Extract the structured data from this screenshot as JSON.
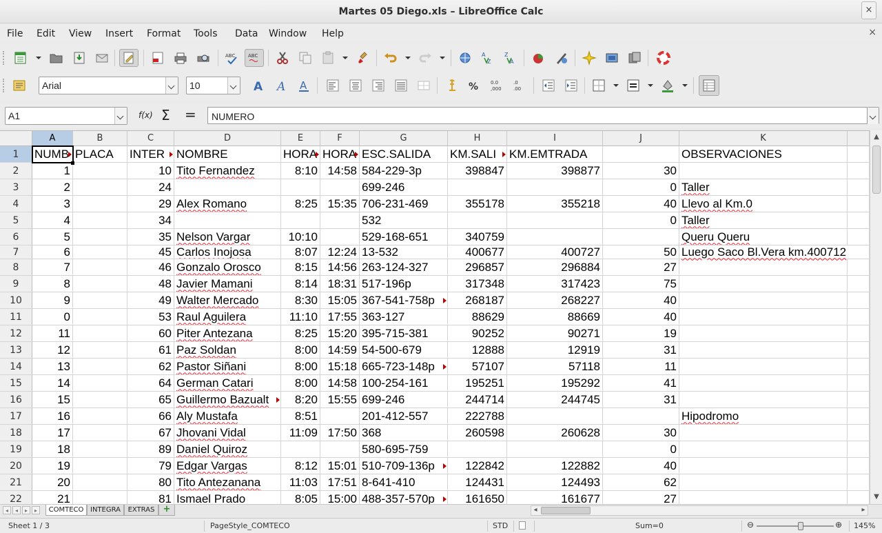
{
  "window": {
    "title": "Martes 05 Diego.xls – LibreOffice Calc",
    "close_glyph": "×"
  },
  "menu": [
    "File",
    "Edit",
    "View",
    "Insert",
    "Format",
    "Tools",
    "Data",
    "Window",
    "Help"
  ],
  "toolbar": {
    "font_name": "Arial",
    "font_size": "10"
  },
  "formula_bar": {
    "name_box": "A1",
    "content": "NUMERO",
    "fx_label": "f(x)",
    "sum_label": "Σ",
    "equals_label": "="
  },
  "columns": [
    "A",
    "B",
    "C",
    "D",
    "E",
    "F",
    "G",
    "H",
    "I",
    "J",
    "K"
  ],
  "column_right_of_k": "",
  "header_row": [
    "NUMB",
    "PLACA",
    "INTER",
    "NOMBRE",
    "HORA",
    "HORA",
    "ESC.SALIDA",
    "KM.SALI",
    "KM.EMTRADA",
    "",
    "OBSERVACIONES"
  ],
  "rows": [
    [
      "1",
      "",
      "10",
      "Tito Fernandez",
      "8:10",
      "14:58",
      "584-229-3p",
      "398847",
      "398877",
      "30",
      ""
    ],
    [
      "2",
      "",
      "24",
      "",
      "",
      "",
      "699-246",
      "",
      "",
      "0",
      "Taller"
    ],
    [
      "3",
      "",
      "29",
      "Alex Romano",
      "8:25",
      "15:35",
      "706-231-469",
      "355178",
      "355218",
      "40",
      "Llevo al Km.0"
    ],
    [
      "4",
      "",
      "34",
      "",
      "",
      "",
      "532",
      "",
      "",
      "0",
      "Taller"
    ],
    [
      "5",
      "",
      "35",
      "Nelson Vargar",
      "10:10",
      "",
      "529-168-651",
      "340759",
      "",
      "",
      "Queru Queru"
    ],
    [
      "6",
      "",
      "45",
      "Carlos Inojosa",
      "8:07",
      "12:24",
      "13-532",
      "400677",
      "400727",
      "50",
      "Luego Saco Bl.Vera km.400712"
    ],
    [
      "7",
      "",
      "46",
      "Gonzalo Orosco",
      "8:15",
      "14:56",
      "263-124-327",
      "296857",
      "296884",
      "27",
      ""
    ],
    [
      "8",
      "",
      "48",
      "Javier Mamani",
      "8:14",
      "18:31",
      "517-196p",
      "317348",
      "317423",
      "75",
      ""
    ],
    [
      "9",
      "",
      "49",
      "Walter Mercado",
      "8:30",
      "15:05",
      "367-541-758p",
      "268187",
      "268227",
      "40",
      ""
    ],
    [
      "0",
      "",
      "53",
      "Raul Aguilera",
      "11:10",
      "17:55",
      "363-127",
      "88629",
      "88669",
      "40",
      ""
    ],
    [
      "11",
      "",
      "60",
      "Piter Antezana",
      "8:25",
      "15:20",
      "395-715-381",
      "90252",
      "90271",
      "19",
      ""
    ],
    [
      "12",
      "",
      "61",
      "Paz Soldan",
      "8:00",
      "14:59",
      "54-500-679",
      "12888",
      "12919",
      "31",
      ""
    ],
    [
      "13",
      "",
      "62",
      "Pastor Siñani",
      "8:00",
      "15:18",
      "665-723-148p",
      "57107",
      "57118",
      "11",
      ""
    ],
    [
      "14",
      "",
      "64",
      "German Catari",
      "8:00",
      "14:58",
      "100-254-161",
      "195251",
      "195292",
      "41",
      ""
    ],
    [
      "15",
      "",
      "65",
      "Guillermo Bazualt",
      "8:20",
      "15:55",
      "699-246",
      "244714",
      "244745",
      "31",
      ""
    ],
    [
      "16",
      "",
      "66",
      "Aly Mustafa",
      "8:51",
      "",
      "201-412-557",
      "222788",
      "",
      "",
      "Hipodromo"
    ],
    [
      "17",
      "",
      "67",
      "Jhovani Vidal",
      "11:09",
      "17:50",
      "368",
      "260598",
      "260628",
      "30",
      ""
    ],
    [
      "18",
      "",
      "89",
      "Daniel Quiroz",
      "",
      "",
      "580-695-759",
      "",
      "",
      "0",
      ""
    ],
    [
      "19",
      "",
      "79",
      "Edgar Vargas",
      "8:12",
      "15:01",
      "510-709-136p",
      "122842",
      "122882",
      "40",
      ""
    ],
    [
      "20",
      "",
      "80",
      "Tito Antezanana",
      "11:03",
      "17:51",
      "8-641-410",
      "124431",
      "124493",
      "62",
      ""
    ],
    [
      "21",
      "",
      "81",
      "Ismael Prado",
      "8:05",
      "15:00",
      "488-357-570p",
      "161650",
      "161677",
      "27",
      ""
    ]
  ],
  "sheets": [
    "COMTECO",
    "INTEGRA",
    "EXTRAS"
  ],
  "status": {
    "sheet": "Sheet 1 / 3",
    "page_style": "PageStyle_COMTECO",
    "mode": "STD",
    "sum": "Sum=0",
    "zoom": "145%"
  },
  "colors": {
    "selection": "#b7cde6",
    "spell_error": "#e23",
    "overflow_arrow": "#b00"
  }
}
